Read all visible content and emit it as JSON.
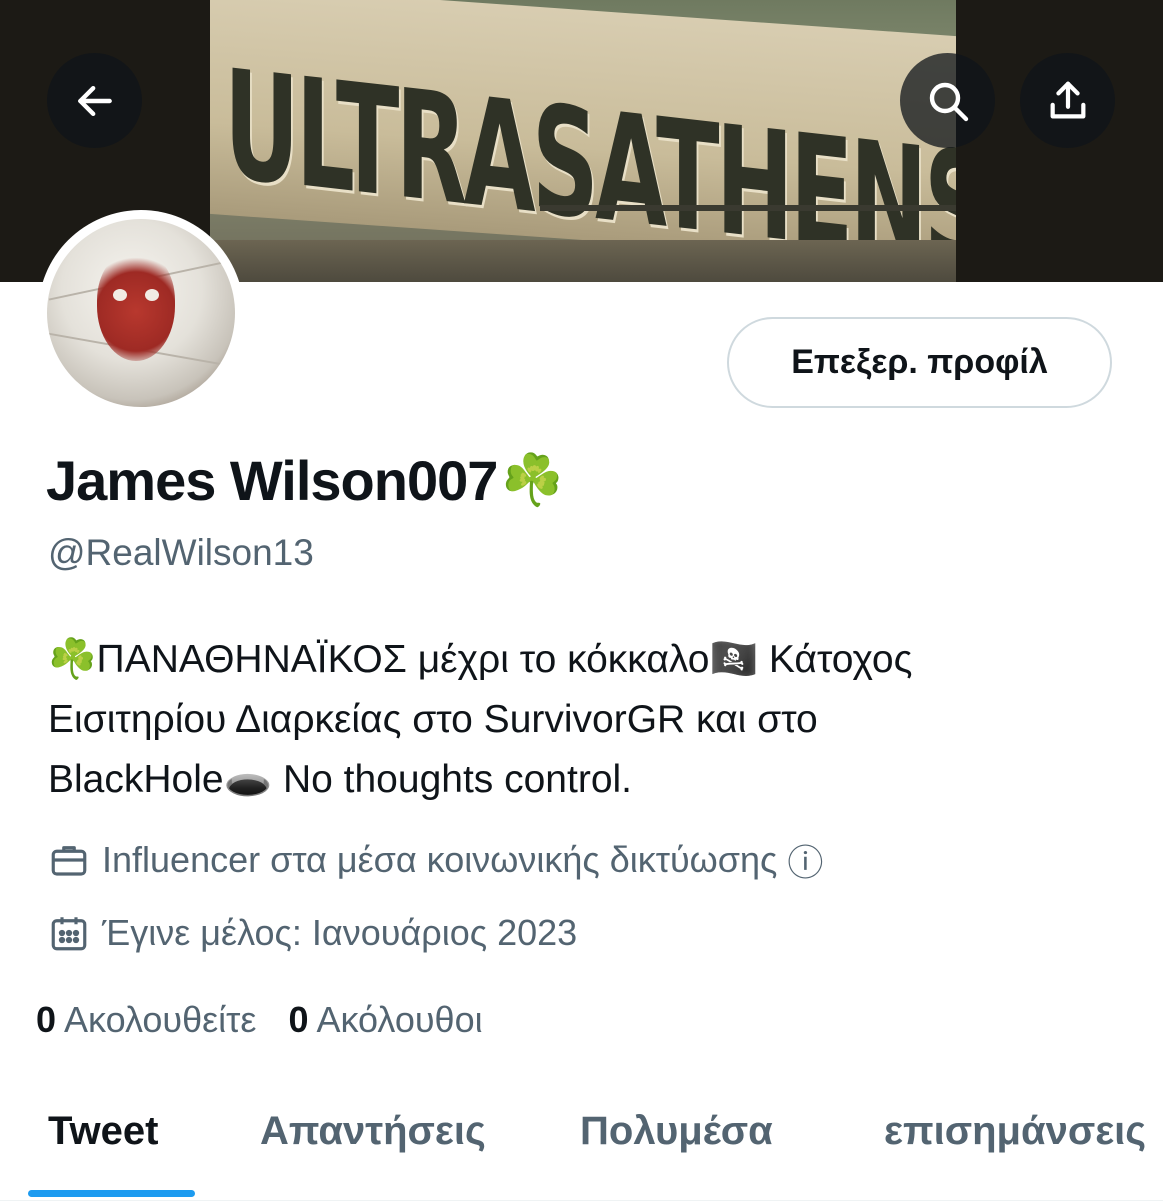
{
  "banner": {
    "art_text": "ULTRASATHENS"
  },
  "toolbar": {
    "back_icon": "arrow-left-icon",
    "search_icon": "search-icon",
    "share_icon": "share-upload-icon"
  },
  "profile": {
    "edit_button_label": "Επεξερ. προφίλ",
    "display_name": "James Wilson007",
    "display_name_emoji": "☘️",
    "handle": "@RealWilson13",
    "bio_lines": [
      "☘️ΠΑΝΑΘΗΝΑΪΚΟΣ μέχρι το κόκκαλο🏴‍☠️ Κάτοχος",
      "Εισιτηρίου Διαρκείας στο SurvivorGR και στο",
      "BlackHole🕳️ No thoughts control."
    ],
    "category": "Influencer στα μέσα κοινωνικής δικτύωσης",
    "category_info": "ⓘ",
    "joined": "Έγινε μέλος: Ιανουάριος 2023",
    "following_count": "0",
    "following_label": "Ακολουθείτε",
    "followers_count": "0",
    "followers_label": "Ακόλουθοι"
  },
  "tabs": [
    {
      "label": "Tweet",
      "active": true
    },
    {
      "label": "Απαντήσεις",
      "active": false
    },
    {
      "label": "Πολυμέσα",
      "active": false
    },
    {
      "label": "επισημάνσεις",
      "active": false
    }
  ],
  "colors": {
    "accent": "#1d9bf0",
    "text_primary": "#0f1419",
    "text_secondary": "#536471"
  }
}
